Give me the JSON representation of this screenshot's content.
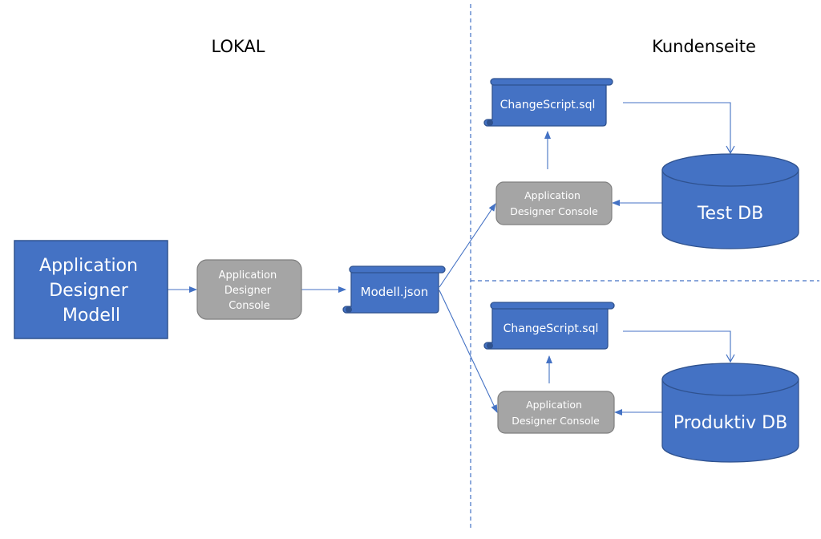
{
  "colors": {
    "shape_blue": "#4472c4",
    "shape_blue_border": "#2f528f",
    "console_gray": "#a5a5a5",
    "console_border": "#7f7f7f",
    "connector": "#4472c4"
  },
  "sections": {
    "local": "LOKAL",
    "customer": "Kundenseite"
  },
  "nodes": {
    "model": [
      "Application",
      "Designer",
      "Modell"
    ],
    "console_local": [
      "Application",
      "Designer",
      "Console"
    ],
    "json": "Modell.json",
    "changescript_test": "ChangeScript.sql",
    "console_test": [
      "Application",
      "Designer Console"
    ],
    "test_db": "Test DB",
    "changescript_prod": "ChangeScript.sql",
    "console_prod": [
      "Application",
      "Designer Console"
    ],
    "prod_db": "Produktiv DB"
  }
}
